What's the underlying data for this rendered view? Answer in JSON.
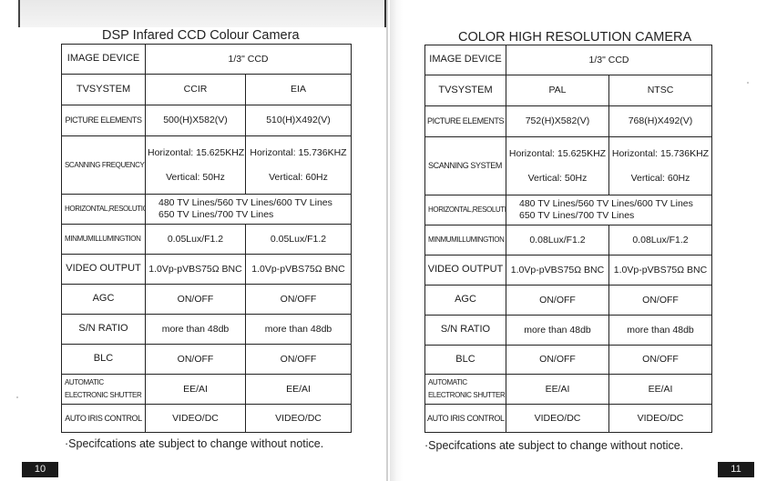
{
  "left_page": {
    "title": "DSP Infared CCD Colour Camera",
    "columns": [
      "CCIR",
      "EIA"
    ],
    "rows": {
      "image_device": {
        "label": "IMAGE DEVICE",
        "value": "1/3\"  CCD"
      },
      "tv_system": {
        "label": "TVSYSTEM",
        "values": [
          "CCIR",
          "EIA"
        ]
      },
      "picture_elements": {
        "label": "PICTURE ELEMENTS",
        "values": [
          "500(H)X582(V)",
          "510(H)X492(V)"
        ]
      },
      "scanning": {
        "label": "SCANNING FREQUENCY",
        "horizontal": [
          "Horizontal: 15.625KHZ",
          "Horizontal: 15.736KHZ"
        ],
        "vertical": [
          "Vertical: 50Hz",
          "Vertical: 60Hz"
        ]
      },
      "resolution": {
        "label": "HORIZONTAL,RESOLUTION",
        "line1": "480 TV Lines/560 TV Lines/600 TV Lines",
        "line2": "650 TV Lines/700 TV Lines"
      },
      "min_illumination": {
        "label": "MINMUMILLUMINGTION",
        "values": [
          "0.05Lux/F1.2",
          "0.05Lux/F1.2"
        ]
      },
      "video_output": {
        "label": "VIDEO OUTPUT",
        "values": [
          "1.0Vp-pVBS75Ω BNC",
          "1.0Vp-pVBS75Ω BNC"
        ]
      },
      "agc": {
        "label": "AGC",
        "values": [
          "ON/OFF",
          "ON/OFF"
        ]
      },
      "sn_ratio": {
        "label": "S/N RATIO",
        "values": [
          "more than 48db",
          "more than 48db"
        ]
      },
      "blc": {
        "label": "BLC",
        "values": [
          "ON/OFF",
          "ON/OFF"
        ]
      },
      "shutter": {
        "label_line1": "AUTOMATIC",
        "label_line2": "ELECTRONIC SHUTTER",
        "values": [
          "EE/AI",
          "EE/AI"
        ]
      },
      "iris": {
        "label": "AUTO IRIS CONTROL",
        "values": [
          "VIDEO/DC",
          "VIDEO/DC"
        ]
      }
    },
    "note": "·Specifcations ate subject to change without notice.",
    "page_number": "10"
  },
  "right_page": {
    "title": "COLOR HIGH RESOLUTION CAMERA",
    "rows": {
      "image_device": {
        "label": "IMAGE DEVICE",
        "value": "1/3\"  CCD"
      },
      "tv_system": {
        "label": "TVSYSTEM",
        "values": [
          "PAL",
          "NTSC"
        ]
      },
      "picture_elements": {
        "label": "PICTURE ELEMENTS",
        "values": [
          "752(H)X582(V)",
          "768(H)X492(V)"
        ]
      },
      "scanning": {
        "label": "SCANNING SYSTEM",
        "horizontal": [
          "Horizontal: 15.625KHZ",
          "Horizontal: 15.736KHZ"
        ],
        "vertical": [
          "Vertical: 50Hz",
          "Vertical: 60Hz"
        ]
      },
      "resolution": {
        "label": "HORIZONTAL,RESOLUTION",
        "line1": "480 TV Lines/560 TV Lines/600 TV Lines",
        "line2": "650 TV Lines/700 TV Lines"
      },
      "min_illumination": {
        "label": "MINMUMILLUMINGTION",
        "values": [
          "0.08Lux/F1.2",
          "0.08Lux/F1.2"
        ]
      },
      "video_output": {
        "label": "VIDEO OUTPUT",
        "values": [
          "1.0Vp-pVBS75Ω BNC",
          "1.0Vp-pVBS75Ω BNC"
        ]
      },
      "agc": {
        "label": "AGC",
        "values": [
          "ON/OFF",
          "ON/OFF"
        ]
      },
      "sn_ratio": {
        "label": "S/N RATIO",
        "values": [
          "more than 48db",
          "more than 48db"
        ]
      },
      "blc": {
        "label": "BLC",
        "values": [
          "ON/OFF",
          "ON/OFF"
        ]
      },
      "shutter": {
        "label_line1": "AUTOMATIC",
        "label_line2": "ELECTRONIC SHUTTER",
        "values": [
          "EE/AI",
          "EE/AI"
        ]
      },
      "iris": {
        "label": "AUTO IRIS CONTROL",
        "values": [
          "VIDEO/DC",
          "VIDEO/DC"
        ]
      }
    },
    "note": "·Specifcations ate subject to change without notice.",
    "page_number": "11"
  }
}
